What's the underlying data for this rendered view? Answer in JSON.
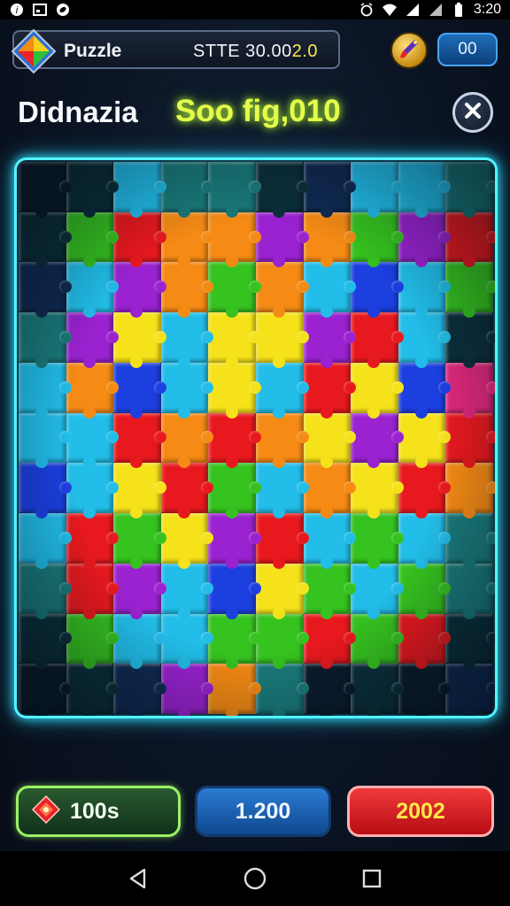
{
  "status_bar": {
    "time": "3:20",
    "left_icons": [
      "app-notification-icon",
      "image-icon",
      "sync-icon"
    ],
    "right_icons": [
      "alarm-icon",
      "wifi-icon",
      "signal-icon",
      "signal-icon",
      "battery-icon"
    ]
  },
  "header": {
    "app_title": "Puzzle",
    "score_prefix": "STTE 30.00",
    "score_highlight": "2.0",
    "counter_label": "00"
  },
  "level": {
    "name": "Didnazia",
    "score_text": "Soo fig,010"
  },
  "board": {
    "columns": 10,
    "rows": 11,
    "palette": {
      "R": "#e8191e",
      "O": "#f58a14",
      "Y": "#f5e21a",
      "G": "#36c21f",
      "C": "#22bde8",
      "B": "#1c3fe0",
      "P": "#9a22d0",
      "M": "#e0287c",
      "T": "#1a7a7a",
      "D": "#0b2f3a",
      "N": "#102a52",
      "K": "#0b1b2c"
    },
    "cells": [
      "KDCTTDNCCT",
      "DGROOPOGPR",
      "NCPOGOCBCG",
      "TPYCYYPRCD",
      "COBCYCRYBM",
      "CCROROYPYR",
      "BCYRGCOYRO",
      "CRGYPRCGCT",
      "TRPCBYGCGT",
      "DGCCGGRGRD",
      "KDNPOTKDKN"
    ]
  },
  "buttons": {
    "green_label": "100s",
    "blue_label": "1.200",
    "red_label": "2002"
  },
  "colors": {
    "board_glow": "#54f3ff",
    "level_score": "#e4ff4a",
    "red_button_text": "#ffe94a"
  }
}
